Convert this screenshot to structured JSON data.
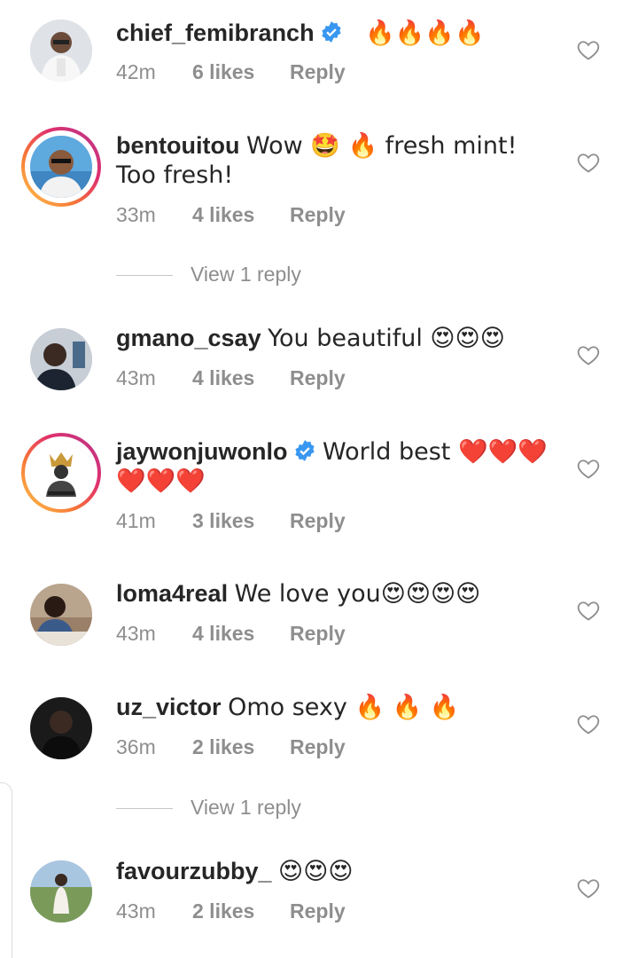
{
  "comments": [
    {
      "username": "chief_femibranch",
      "verified": true,
      "text": "🔥🔥🔥🔥",
      "time": "42m",
      "likes": "6 likes",
      "reply": "Reply"
    },
    {
      "username": "bentouitou",
      "verified": false,
      "text": "Wow 🤩 🔥 fresh mint! Too fresh!",
      "time": "33m",
      "likes": "4 likes",
      "reply": "Reply",
      "view_replies": "View 1 reply"
    },
    {
      "username": "gmano_csay",
      "verified": false,
      "text": "You beautiful 😍😍😍",
      "time": "43m",
      "likes": "4 likes",
      "reply": "Reply"
    },
    {
      "username": "jaywonjuwonlo",
      "verified": true,
      "text": "World best ❤️❤️❤️❤️❤️❤️",
      "time": "41m",
      "likes": "3 likes",
      "reply": "Reply"
    },
    {
      "username": "loma4real",
      "verified": false,
      "text": "We love you😍😍😍😍",
      "time": "43m",
      "likes": "4 likes",
      "reply": "Reply"
    },
    {
      "username": "uz_victor",
      "verified": false,
      "text": "Omo sexy 🔥 🔥 🔥",
      "time": "36m",
      "likes": "2 likes",
      "reply": "Reply",
      "view_replies": "View 1 reply"
    },
    {
      "username": "favourzubby_",
      "verified": false,
      "text": "😍😍😍",
      "time": "43m",
      "likes": "2 likes",
      "reply": "Reply"
    }
  ],
  "colors": {
    "text": "#262626",
    "secondary": "#8e8e8e",
    "verified_blue": "#3897f0"
  },
  "icons": {
    "like": "heart-outline-icon",
    "verified": "verified-badge-icon"
  }
}
